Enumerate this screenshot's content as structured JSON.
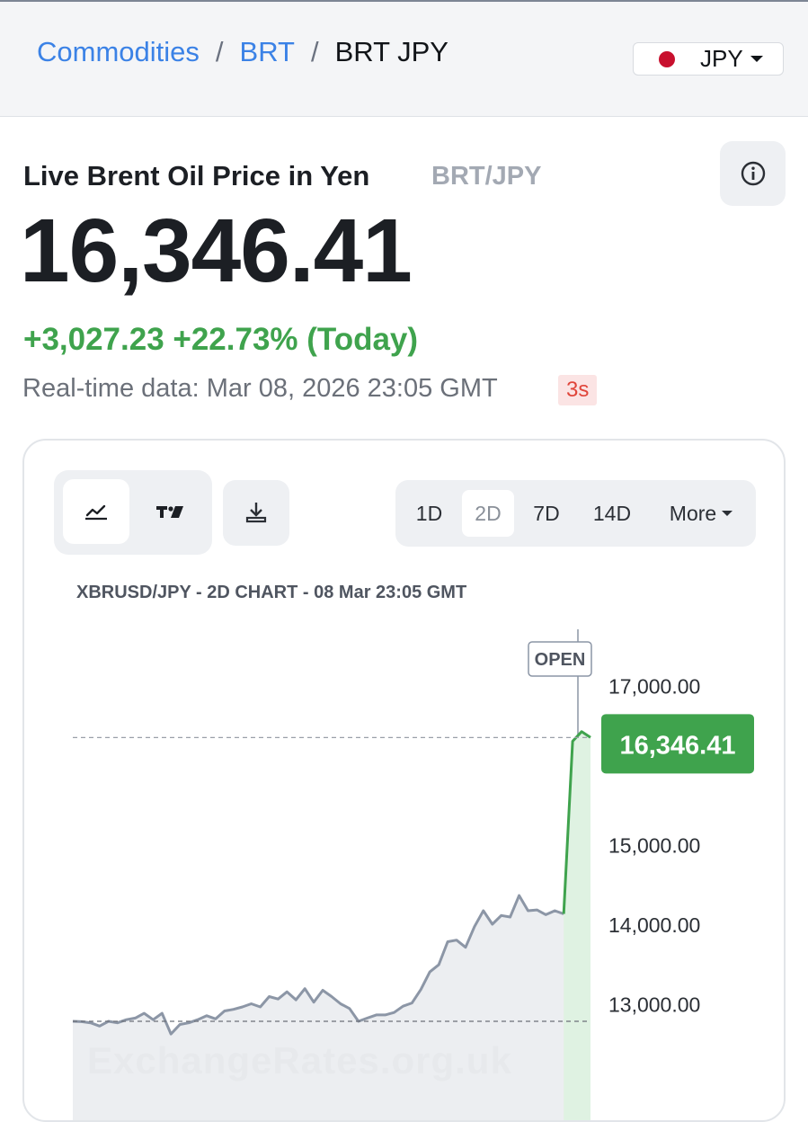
{
  "breadcrumb": {
    "link1": "Commodities",
    "link2": "BRT",
    "current": "BRT JPY",
    "sep": "/"
  },
  "currency_select": {
    "value": "JPY",
    "flag_color": "#c8102e"
  },
  "heading": {
    "title": "Live Brent Oil Price in Yen",
    "pair": "BRT/JPY"
  },
  "price": {
    "value": "16,346.41",
    "change": "+3,027.23 +22.73% (Today)"
  },
  "realtime": {
    "text": "Real-time data: Mar 08, 2026 23:05 GMT",
    "age": "3s"
  },
  "chart_controls": {
    "ranges": [
      "1D",
      "2D",
      "7D",
      "14D"
    ],
    "active_range": "2D",
    "more_label": "More"
  },
  "chart_title": "XBRUSD/JPY - 2D CHART - 08 Mar 23:05 GMT",
  "open_label": "OPEN",
  "watermark": "ExchangeRates.org.uk",
  "colors": {
    "accent": "#3b82e6",
    "positive": "#3fa34d",
    "line": "#8c96a6",
    "price_tag": "#3fa34d"
  },
  "chart_data": {
    "type": "area",
    "title": "XBRUSD/JPY - 2D CHART - 08 Mar 23:05 GMT",
    "yticks": [
      17000,
      15000,
      14000,
      13000
    ],
    "ytick_labels": [
      "17,000.00",
      "15,000.00",
      "14,000.00",
      "13,000.00"
    ],
    "last_value": 16346.41,
    "last_label": "16,346.41",
    "reference_line": 12780,
    "series": [
      {
        "values": [
          12780,
          12775,
          12760,
          12720,
          12780,
          12760,
          12800,
          12820,
          12880,
          12800,
          12880,
          12620,
          12740,
          12760,
          12800,
          12850,
          12810,
          12910,
          12930,
          12960,
          13000,
          12960,
          13090,
          13060,
          13150,
          13050,
          13190,
          13020,
          13170,
          13090,
          13000,
          12940,
          12780,
          12820,
          12860,
          12860,
          12890,
          12970,
          13010,
          13180,
          13400,
          13490,
          13780,
          13800,
          13710,
          13970,
          14170,
          14000,
          14110,
          14090,
          14360,
          14170,
          14180,
          14120,
          14170,
          14130,
          16300,
          16420,
          16346.41
        ]
      }
    ]
  }
}
